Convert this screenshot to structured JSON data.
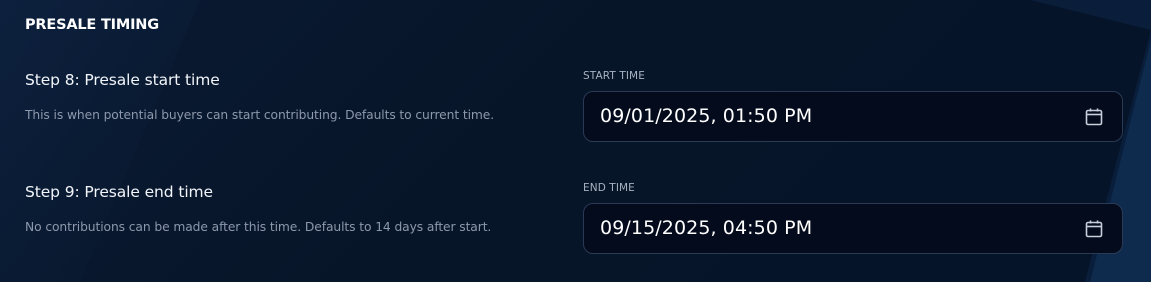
{
  "section": {
    "title": "PRESALE TIMING"
  },
  "steps": [
    {
      "title": "Step 8: Presale start time",
      "description": "This is when potential buyers can start contributing. Defaults to current time.",
      "field_label": "START TIME",
      "value": "09/01/2025, 01:50 PM",
      "icon": "calendar-icon"
    },
    {
      "title": "Step 9: Presale end time",
      "description": "No contributions can be made after this time. Defaults to 14 days after start.",
      "field_label": "END TIME",
      "value": "09/15/2025, 04:50 PM",
      "icon": "calendar-icon"
    }
  ],
  "colors": {
    "background": "#061224",
    "input_background": "#030b1c",
    "input_border": "#2a3a55",
    "text_primary": "#ffffff",
    "text_muted": "#8d98ab"
  }
}
